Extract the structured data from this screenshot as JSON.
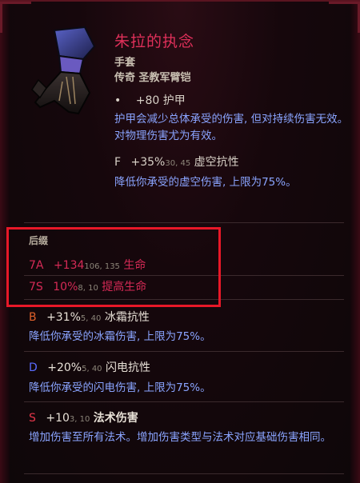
{
  "item": {
    "name": "朱拉的执念",
    "type": "手套",
    "rarity": "传奇 圣教军臂铠",
    "armor": {
      "bullet": "•",
      "value": "+80",
      "label": "护甲"
    },
    "armor_desc": "护甲会减少总体承受的伤害, 但对持续伤害无效。对物理伤害尤为有效。",
    "fire_resist": {
      "letter": "F",
      "value": "+35%",
      "range": "30, 45",
      "label": "虚空抗性"
    },
    "fire_desc": "降低你承受的虚空伤害, 上限为75%。"
  },
  "suffix": {
    "label": "后缀",
    "rows": [
      {
        "code": "7A",
        "value": "+134",
        "range": "106, 135",
        "label": "生命"
      },
      {
        "code": "7S",
        "value": "10%",
        "range": "8, 10",
        "label": "提高生命"
      }
    ]
  },
  "affixes": [
    {
      "letter": "B",
      "value": "+31%",
      "range": "5, 40",
      "label": "冰霜抗性",
      "desc": "降低你承受的冰霜伤害, 上限为75%。"
    },
    {
      "letter": "D",
      "value": "+20%",
      "range": "5, 40",
      "label": "闪电抗性",
      "desc": "降低你承受的闪电伤害, 上限为75%。"
    },
    {
      "letter": "S",
      "value": "+10",
      "range": "3, 10",
      "label": "法术伤害",
      "desc": "增加伤害至所有法术。增加伤害类型与法术对应基础伤害相同。"
    }
  ],
  "colors": {
    "title": "#e0305a",
    "desc": "#8aa4ff",
    "highlight_box": "#e81828"
  },
  "icons": {
    "item": "gauntlet-icon"
  }
}
